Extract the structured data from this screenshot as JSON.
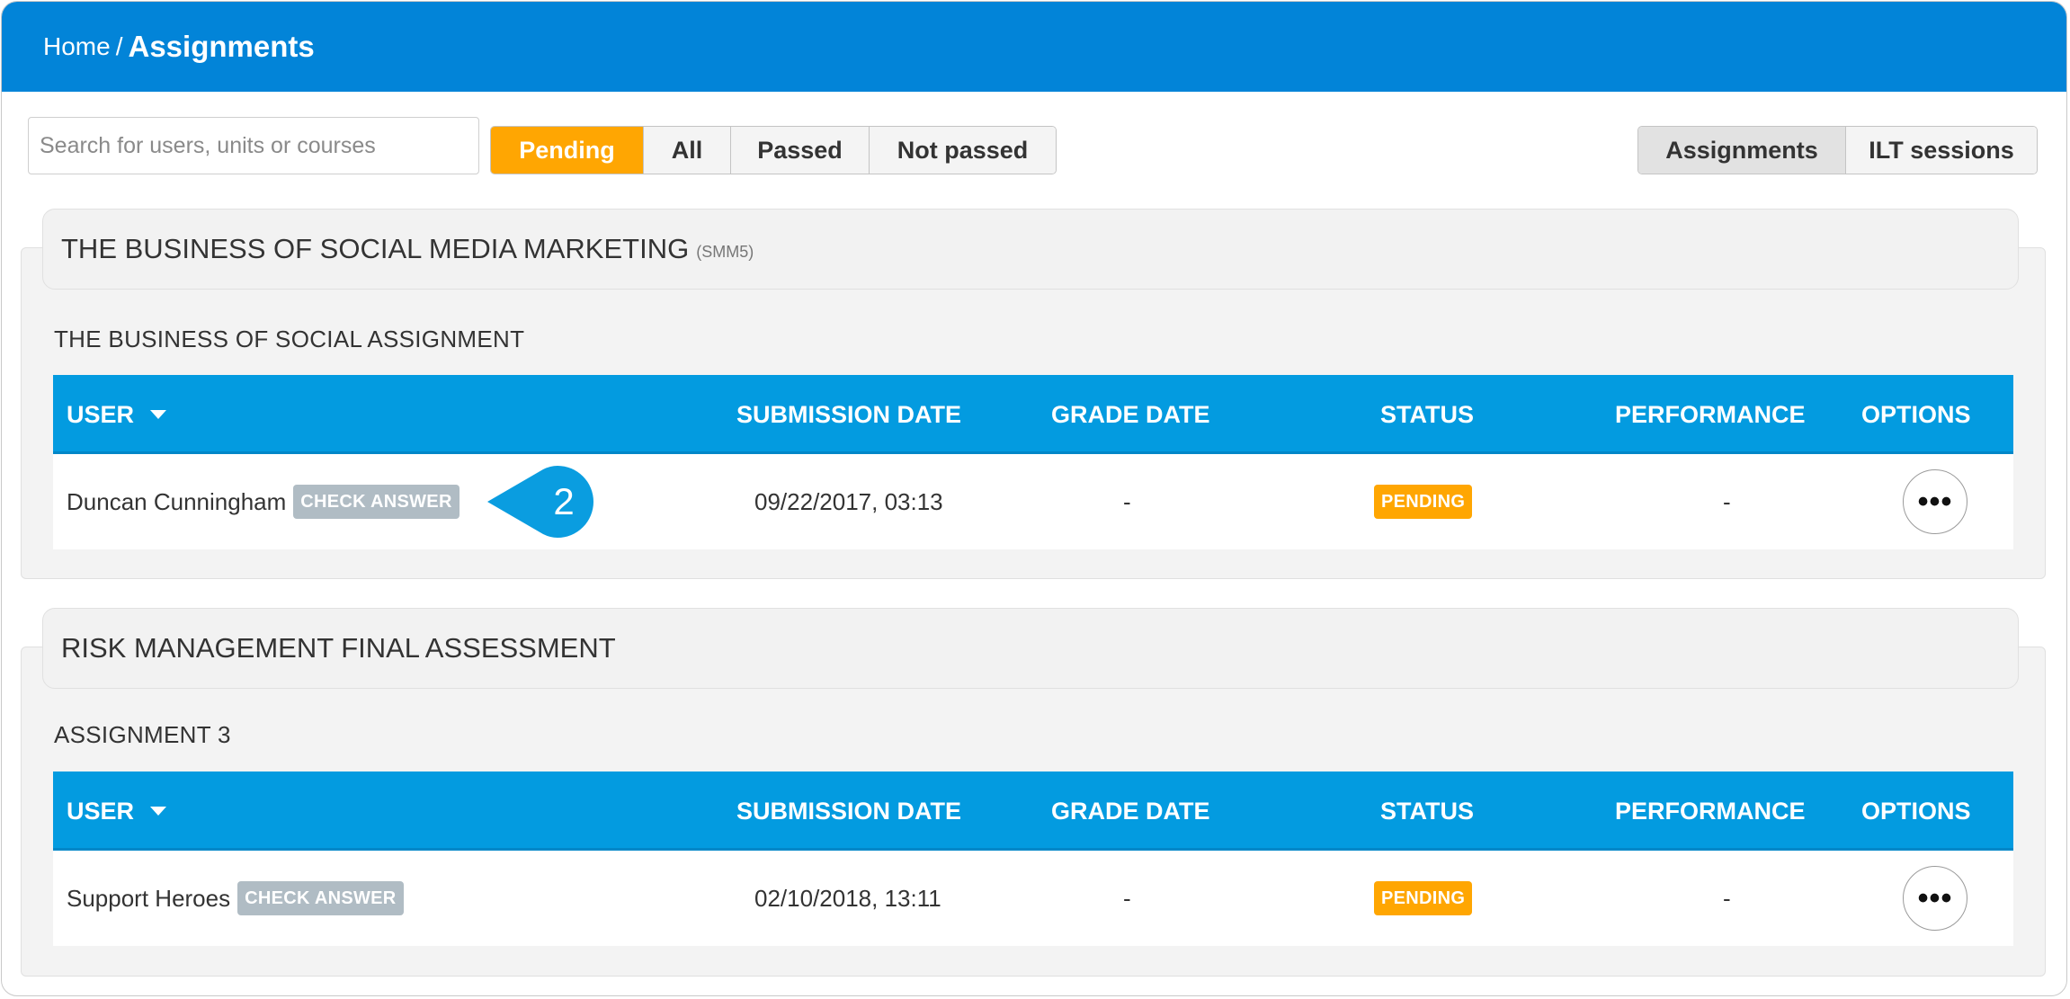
{
  "breadcrumb": {
    "home": "Home",
    "separator": "/",
    "current": "Assignments"
  },
  "search": {
    "placeholder": "Search for users, units or courses",
    "value": ""
  },
  "filters": [
    "Pending",
    "All",
    "Passed",
    "Not passed"
  ],
  "views": [
    "Assignments",
    "ILT sessions"
  ],
  "colors": {
    "accent": "#0284d8",
    "table_header": "#039be0",
    "pending": "#ffa602",
    "check_answer": "#b0bcc4"
  },
  "columns": {
    "user": "USER",
    "submission_date": "SUBMISSION DATE",
    "grade_date": "GRADE DATE",
    "status": "STATUS",
    "performance": "PERFORMANCE",
    "options": "OPTIONS"
  },
  "sections": [
    {
      "course": "THE BUSINESS OF SOCIAL MEDIA MARKETING",
      "code": "(SMM5)",
      "assignment": "THE BUSINESS OF SOCIAL ASSIGNMENT",
      "rows": [
        {
          "user": "Duncan Cunningham",
          "check_label": "CHECK ANSWER",
          "submission_date": "09/22/2017, 03:13",
          "grade_date": "-",
          "status": "PENDING",
          "performance": "-",
          "options_icon": "more-horizontal-icon"
        }
      ]
    },
    {
      "course": "RISK MANAGEMENT FINAL ASSESSMENT",
      "code": "",
      "assignment": "ASSIGNMENT 3",
      "rows": [
        {
          "user": "Support Heroes",
          "check_label": "CHECK ANSWER",
          "submission_date": "02/10/2018, 13:11",
          "grade_date": "-",
          "status": "PENDING",
          "performance": "-",
          "options_icon": "more-horizontal-icon"
        }
      ]
    }
  ],
  "callout": {
    "number": "2"
  }
}
